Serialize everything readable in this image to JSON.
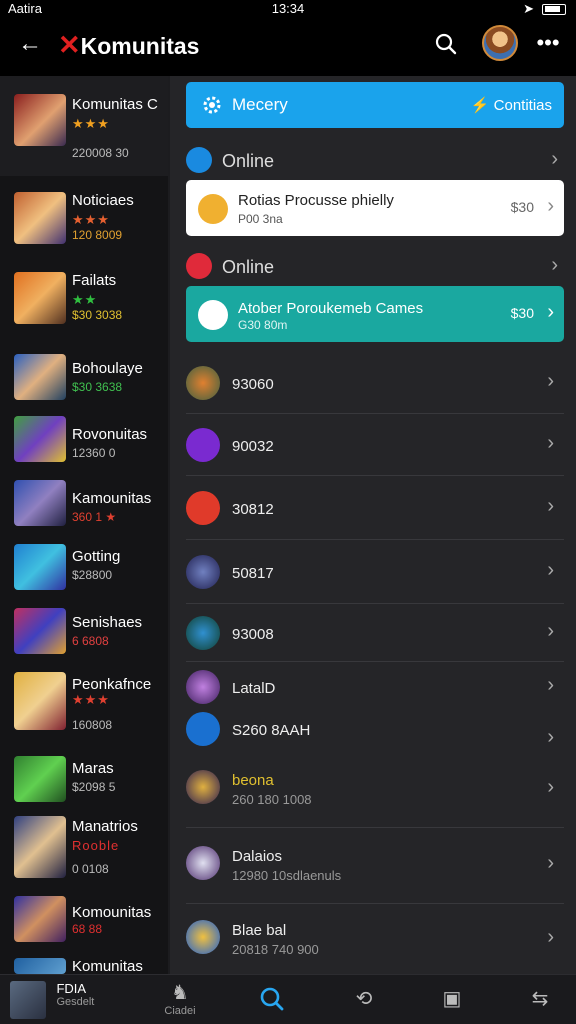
{
  "status": {
    "carrier": "Aatira",
    "time": "13:34"
  },
  "header": {
    "title": "Komunitas",
    "search_icon": "search-icon",
    "more_icon": "more-icon"
  },
  "sidebar": {
    "items": [
      {
        "name": "Komunitas C",
        "stars": "★★★",
        "meta": "220008 30"
      },
      {
        "name": "Noticiaes",
        "stars": "★★★",
        "meta": "120 8009"
      },
      {
        "name": "Failats",
        "stars": "★★",
        "meta": "$30 3038"
      },
      {
        "name": "Bohoulaye",
        "stars": "",
        "meta": "$30 3638"
      },
      {
        "name": "Rovonuitas",
        "stars": "",
        "meta": "12360 0"
      },
      {
        "name": "Kamounitas",
        "stars": "",
        "meta": "360 1 ★"
      },
      {
        "name": "Gotting",
        "stars": "",
        "meta": "$28800"
      },
      {
        "name": "Senishaes",
        "stars": "",
        "meta": "6 6808"
      },
      {
        "name": "Peonkafnce",
        "stars": "★★★",
        "meta": "160808"
      },
      {
        "name": "Maras",
        "stars": "",
        "meta": "$2098 5"
      },
      {
        "name": "Manatrios",
        "stars": "Rooble",
        "meta": "0 0108"
      },
      {
        "name": "Komounitas",
        "stars": "",
        "meta": "68 88"
      },
      {
        "name": "Komunitas",
        "stars": "",
        "meta": ""
      }
    ]
  },
  "main": {
    "banner": {
      "label": "Mecery",
      "action": "Contitias",
      "color": "#1aa3ec"
    },
    "sections": [
      {
        "label": "Online"
      },
      {
        "label": "Online"
      }
    ],
    "cards": [
      {
        "title": "Rotias Procusse phielly",
        "subtitle": "P00 3na",
        "value": "$30"
      },
      {
        "title": "Atober Poroukemeb Cames",
        "subtitle": "G30 80m",
        "value": "$30"
      }
    ],
    "rows": [
      {
        "title": "93060",
        "subtitle": ""
      },
      {
        "title": "90032",
        "subtitle": ""
      },
      {
        "title": "30812",
        "subtitle": ""
      },
      {
        "title": "50817",
        "subtitle": ""
      },
      {
        "title": "93008",
        "subtitle": ""
      },
      {
        "title": "LatalD",
        "subtitle": ""
      },
      {
        "title": "S260 8AAH",
        "subtitle": ""
      },
      {
        "title": "beona",
        "subtitle": "260 180 1008"
      },
      {
        "title": "Dalaios",
        "subtitle": "12980 10sdlaenuls"
      },
      {
        "title": "Blae bal",
        "subtitle": "20818 740 900"
      }
    ]
  },
  "bottom_nav": {
    "items": [
      {
        "icon": "game-icon",
        "label": "Ciadei"
      },
      {
        "icon": "search-icon",
        "label": ""
      },
      {
        "icon": "community-icon",
        "label": ""
      },
      {
        "icon": "bag-icon",
        "label": ""
      },
      {
        "icon": "inbox-icon",
        "label": ""
      }
    ],
    "profile": {
      "name": "FDIA",
      "label": "Gesdelt"
    }
  },
  "colors": {
    "accent": "#1aa3ec",
    "teal_card": "#1aa8a0",
    "brand_red": "#e02020"
  }
}
